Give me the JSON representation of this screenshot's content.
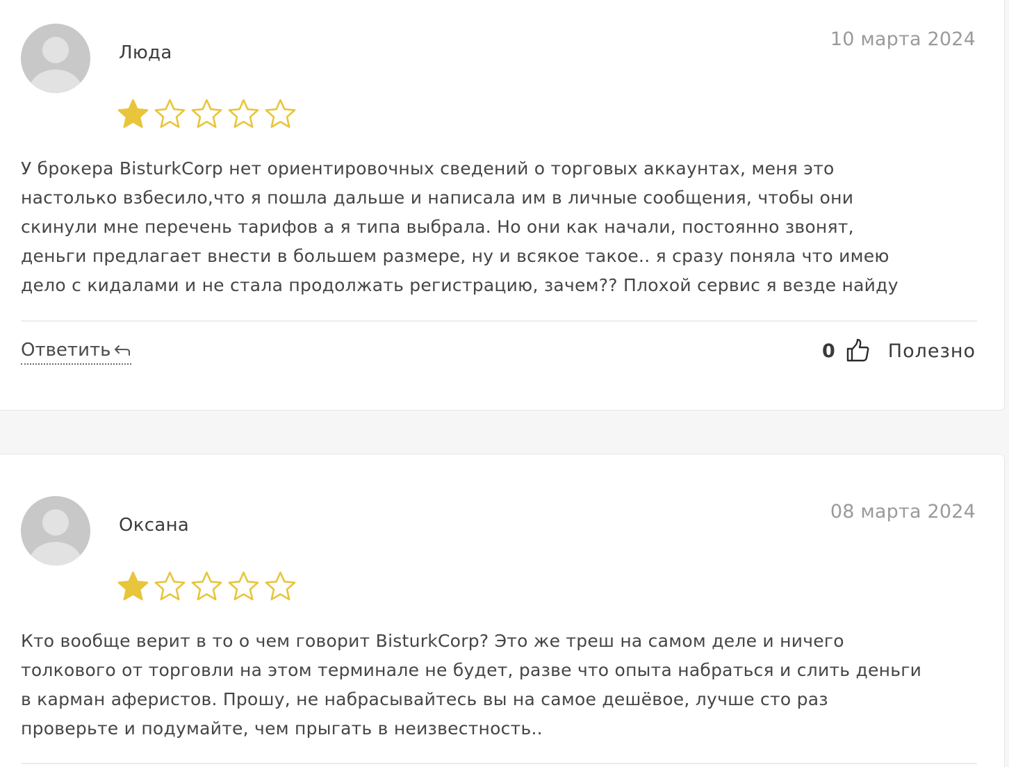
{
  "reviews": [
    {
      "author": "Люда",
      "date": "10 марта 2024",
      "rating": 1,
      "max_rating": 5,
      "text_lines": [
        "У брокера BisturkCorp нет ориентировочных сведений о торговых аккаунтах, меня это",
        "настолько взбесило,что я пошла дальше и написала им в личные сообщения, чтобы они",
        "скинули мне перечень тарифов а я типа выбрала. Но они как начали, постоянно звонят,",
        "деньги предлагает внести в большем размере, ну и всякое такое.. я сразу поняла что имею",
        "дело с кидалами и не стала продолжать регистрацию, зачем?? Плохой сервис я везде найду"
      ],
      "reply_label": "Ответить",
      "helpful_count": "0",
      "helpful_label": "Полезно"
    },
    {
      "author": "Оксана",
      "date": "08 марта 2024",
      "rating": 1,
      "max_rating": 5,
      "text_lines": [
        "Кто вообще верит в то о чем говорит BisturkCorp? Это же треш на самом деле и ничего",
        "толкового от торговли на этом терминале не будет, разве что опыта набраться и слить деньги",
        "в карман аферистов. Прошу, не набрасывайтесь вы на самое дешёвое, лучше сто раз",
        "проверьте и подумайте, чем прыгать в неизвестность.."
      ]
    }
  ],
  "colors": {
    "star_fill": "#e8c53a",
    "star_outline": "#e8c53a"
  },
  "icons": {
    "avatar": "user-avatar-placeholder-icon",
    "star": "star-icon",
    "reply": "reply-arrow-icon",
    "thumb": "thumbs-up-icon"
  }
}
